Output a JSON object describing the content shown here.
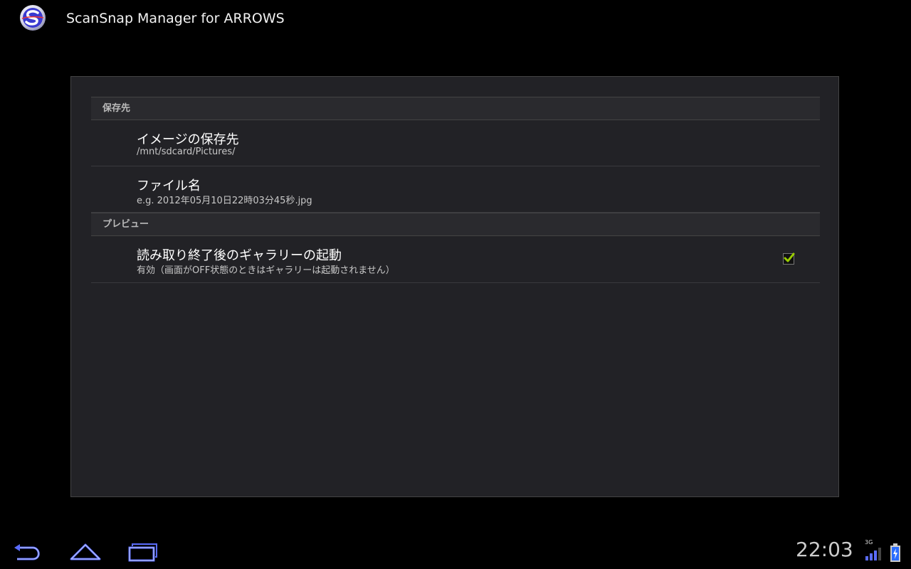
{
  "app": {
    "title": "ScanSnap Manager for ARROWS",
    "logo_icon": "scansnap-logo-icon"
  },
  "settings": {
    "categories": [
      {
        "label": "保存先",
        "items": [
          {
            "title": "イメージの保存先",
            "summary": "/mnt/sdcard/Pictures/"
          },
          {
            "title": "ファイル名",
            "summary": "e.g. 2012年05月10日22時03分45秒.jpg"
          }
        ]
      },
      {
        "label": "プレビュー",
        "items": [
          {
            "title": "読み取り終了後のギャラリーの起動",
            "summary": "有効（画面がOFF状態のときはギャラリーは起動されません）",
            "checked": true
          }
        ]
      }
    ]
  },
  "system_bar": {
    "time": "22:03",
    "network": "3G",
    "icons": [
      "back-icon",
      "home-icon",
      "recent-apps-icon",
      "signal-icon",
      "battery-icon"
    ]
  },
  "colors": {
    "accent": "#99cc00",
    "panel_bg": "#222226",
    "logo_blue": "#3a3ad0"
  }
}
